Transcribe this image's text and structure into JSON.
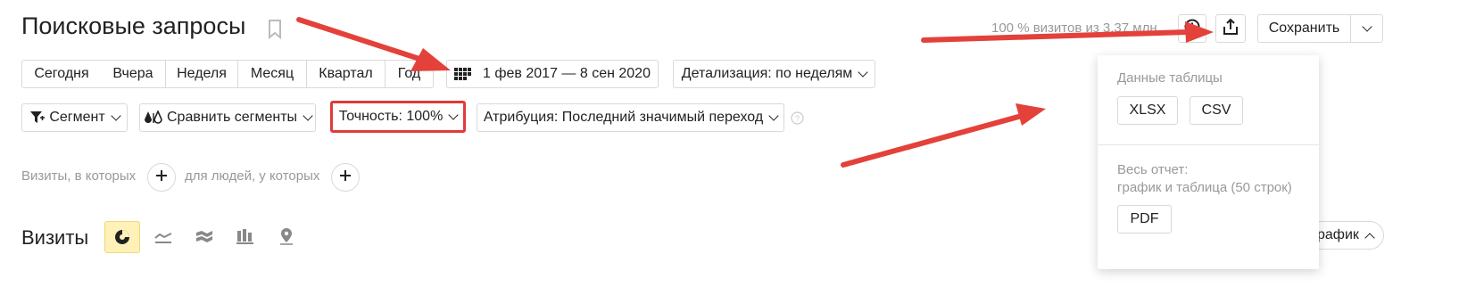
{
  "header": {
    "title": "Поисковые запросы",
    "visits_info": "100 % визитов из 3,37 млн",
    "save_label": "Сохранить"
  },
  "periods": [
    "Сегодня",
    "Вчера",
    "Неделя",
    "Месяц",
    "Квартал",
    "Год"
  ],
  "date_range": "1 фев 2017 — 8 сен 2020",
  "detail_label": "Детализация: по неделям",
  "filters": {
    "segment": "Сегмент",
    "compare": "Сравнить сегменты",
    "accuracy": "Точность: 100%",
    "attribution": "Атрибуция: Последний значимый переход"
  },
  "conditions": {
    "visits_label": "Визиты, в которых",
    "people_label": "для людей, у которых"
  },
  "chart_section": {
    "title": "Визиты",
    "hide_chart_label": "Скрыть график"
  },
  "export_menu": {
    "table_heading": "Данные таблицы",
    "xlsx_label": "XLSX",
    "csv_label": "CSV",
    "report_heading_line1": "Весь отчет:",
    "report_heading_line2": "график и таблица (50 строк)",
    "pdf_label": "PDF"
  },
  "colors": {
    "highlight_border": "#e03a3a",
    "arrow": "#e3413a",
    "active_chart_bg": "#fff1b8",
    "muted_text": "#999999"
  },
  "icons": [
    "bookmark-icon",
    "calendar-icon",
    "clock-icon",
    "export-icon",
    "filter-icon",
    "compare-icon",
    "help-icon",
    "plus-icon",
    "pie-chart-icon",
    "line-chart-icon",
    "area-chart-icon",
    "bar-chart-icon",
    "map-icon"
  ]
}
